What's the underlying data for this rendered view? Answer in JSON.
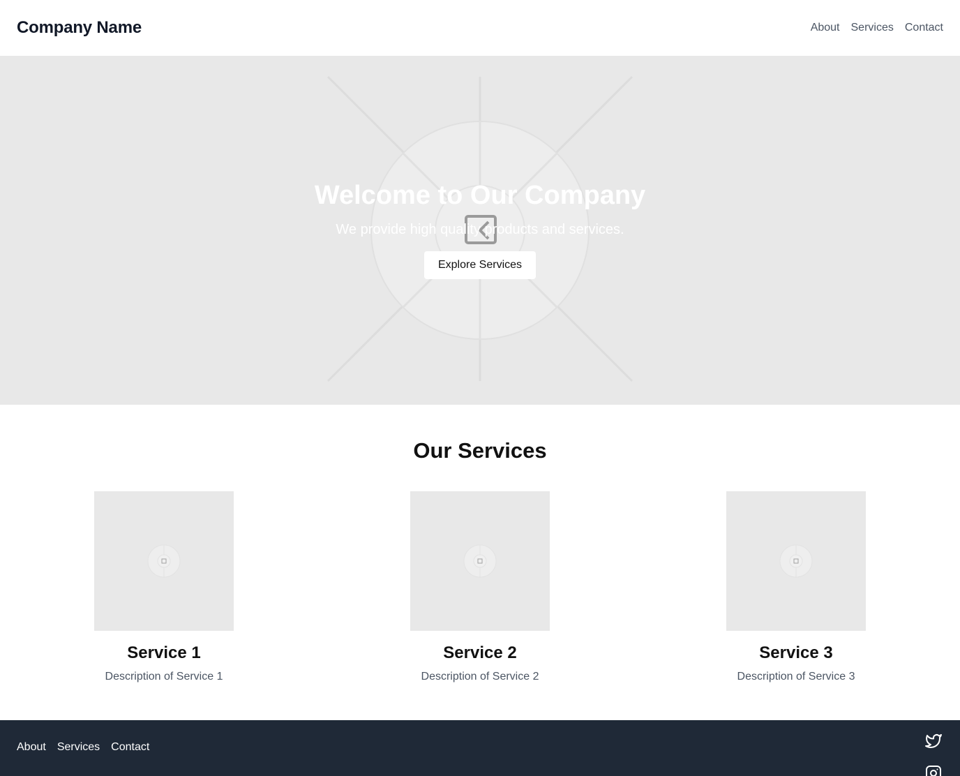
{
  "header": {
    "brand": "Company Name",
    "nav": [
      "About",
      "Services",
      "Contact"
    ]
  },
  "hero": {
    "title": "Welcome to Our Company",
    "subtitle": "We provide high quality products and services.",
    "cta_label": "Explore Services",
    "background_icon": "image-placeholder-icon"
  },
  "services": {
    "title": "Our Services",
    "items": [
      {
        "title": "Service 1",
        "description": "Description of Service 1",
        "image_icon": "image-placeholder-icon"
      },
      {
        "title": "Service 2",
        "description": "Description of Service 2",
        "image_icon": "image-placeholder-icon"
      },
      {
        "title": "Service 3",
        "description": "Description of Service 3",
        "image_icon": "image-placeholder-icon"
      }
    ]
  },
  "footer": {
    "nav": [
      "About",
      "Services",
      "Contact"
    ],
    "social_icons": [
      "facebook-icon",
      "twitter-icon",
      "instagram-icon"
    ]
  },
  "colors": {
    "header_bg": "#ffffff",
    "hero_bg": "#e8e8e8",
    "footer_bg": "#1f2937",
    "nav_text": "#4b5563",
    "heading_text": "#111827"
  }
}
